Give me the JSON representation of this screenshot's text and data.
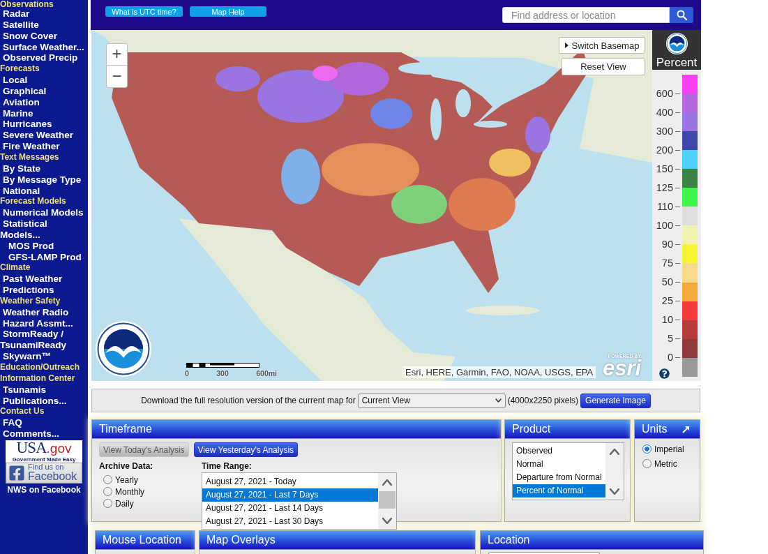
{
  "sidebar": {
    "sections": [
      {
        "title": "Observations",
        "items": [
          {
            "label": "Radar"
          },
          {
            "label": "Satellite"
          },
          {
            "label": "Snow Cover"
          },
          {
            "label": "Surface Weather..."
          },
          {
            "label": "Observed Precip"
          }
        ]
      },
      {
        "title": "Forecasts",
        "items": [
          {
            "label": "Local"
          },
          {
            "label": "Graphical"
          },
          {
            "label": "Aviation"
          },
          {
            "label": "Marine"
          },
          {
            "label": "Hurricanes"
          },
          {
            "label": "Severe Weather"
          },
          {
            "label": "Fire Weather"
          }
        ]
      },
      {
        "title": "Text Messages",
        "items": [
          {
            "label": "By State"
          },
          {
            "label": "By Message Type"
          },
          {
            "label": "National"
          }
        ]
      },
      {
        "title": "Forecast Models",
        "items": [
          {
            "label": "Numerical Models"
          },
          {
            "label": "Statistical Models...",
            "children": [
              {
                "label": "MOS Prod"
              },
              {
                "label": "GFS-LAMP Prod"
              }
            ]
          }
        ]
      },
      {
        "title": "Climate",
        "items": [
          {
            "label": "Past Weather"
          },
          {
            "label": "Predictions"
          }
        ]
      },
      {
        "title": "Weather Safety",
        "items": [
          {
            "label": "Weather Radio"
          },
          {
            "label": "Hazard Assmt..."
          },
          {
            "label": "StormReady / TsunamiReady"
          },
          {
            "label": "Skywarn™"
          }
        ]
      },
      {
        "title": "Education/Outreach"
      },
      {
        "title": "Information Center",
        "items": [
          {
            "label": "Tsunamis"
          },
          {
            "label": "Publications..."
          }
        ]
      },
      {
        "title": "Contact Us",
        "items": [
          {
            "label": "FAQ"
          },
          {
            "label": "Comments..."
          }
        ]
      }
    ],
    "usagov_badge": {
      "logo_text": [
        "USA",
        ".gov"
      ],
      "tagline": "Government Made Easy"
    },
    "facebook_badge": {
      "intro": "Find us on",
      "brand": "Facebook"
    },
    "facebook_caption": "NWS on Facebook"
  },
  "header": {
    "buttons": [
      "What is UTC time?",
      "Map Help"
    ],
    "search": {
      "placeholder": "Find address or location"
    }
  },
  "map": {
    "zoom_buttons": [
      "+",
      "−"
    ],
    "basemap_button": "Switch Basemap",
    "reset_button": "Reset View",
    "scale_labels": [
      "0",
      "300",
      "600mi"
    ],
    "attribution": "Esri, HERE, Garmin, FAO, NOAA, USGS, EPA",
    "esri_logo": {
      "tagline": "POWERED BY",
      "name": "esri"
    }
  },
  "legend": {
    "title": "Percent",
    "scale": [
      {
        "color": "#f53ef5",
        "label": "600"
      },
      {
        "color": "#b266dc",
        "label": "400"
      },
      {
        "color": "#9a74e0",
        "label": "300"
      },
      {
        "color": "#3d48a8",
        "label": "200"
      },
      {
        "color": "#4cd0f5",
        "label": "150"
      },
      {
        "color": "#3b8446",
        "label": "125"
      },
      {
        "color": "#3ef54a",
        "label": "110"
      },
      {
        "color": "#dedede",
        "label": "100"
      },
      {
        "color": "#f2f2b0",
        "label": "90"
      },
      {
        "color": "#f5f532",
        "label": "75"
      },
      {
        "color": "#f7d98a",
        "label": "50"
      },
      {
        "color": "#f5a83c",
        "label": "25"
      },
      {
        "color": "#f53c3c",
        "label": "10"
      },
      {
        "color": "#b83a3a",
        "label": "5"
      },
      {
        "color": "#913a3a",
        "label": "0"
      },
      {
        "color": "#999999"
      }
    ]
  },
  "download": {
    "text": "Download the full resolution version of the current map for",
    "select": {
      "value": "Current View"
    },
    "size_note": "(4000x2250 pixels)",
    "button": "Generate Image"
  },
  "timeframe": {
    "title": "Timeframe",
    "buttons": [
      {
        "label": "View Today's Analysis",
        "disabled": true
      },
      {
        "label": "View Yesterday's Analysis",
        "disabled": false
      }
    ],
    "archive": {
      "label": "Archive Data:",
      "options": [
        {
          "label": "Yearly",
          "selected": false
        },
        {
          "label": "Monthly",
          "selected": false
        },
        {
          "label": "Daily",
          "selected": false
        }
      ]
    },
    "time_range": {
      "label": "Time Range:",
      "options": [
        {
          "label": "August 27, 2021 - Today",
          "selected": false
        },
        {
          "label": "August 27, 2021 - Last 7 Days",
          "selected": true
        },
        {
          "label": "August 27, 2021 - Last 14 Days",
          "selected": false
        },
        {
          "label": "August 27, 2021 - Last 30 Days",
          "selected": false
        }
      ]
    }
  },
  "product": {
    "title": "Product",
    "options": [
      {
        "label": "Observed",
        "selected": false
      },
      {
        "label": "Normal",
        "selected": false
      },
      {
        "label": "Departure from Normal",
        "selected": false
      },
      {
        "label": "Percent of Normal",
        "selected": true
      }
    ]
  },
  "units": {
    "title": "Units",
    "options": [
      {
        "label": "Imperial",
        "selected": true
      },
      {
        "label": "Metric",
        "selected": false
      }
    ]
  },
  "lower_panels": [
    {
      "title": "Mouse Location",
      "kind": "readout"
    },
    {
      "title": "Map Overlays",
      "kind": "overlays"
    },
    {
      "title": "Location",
      "kind": "search"
    }
  ]
}
